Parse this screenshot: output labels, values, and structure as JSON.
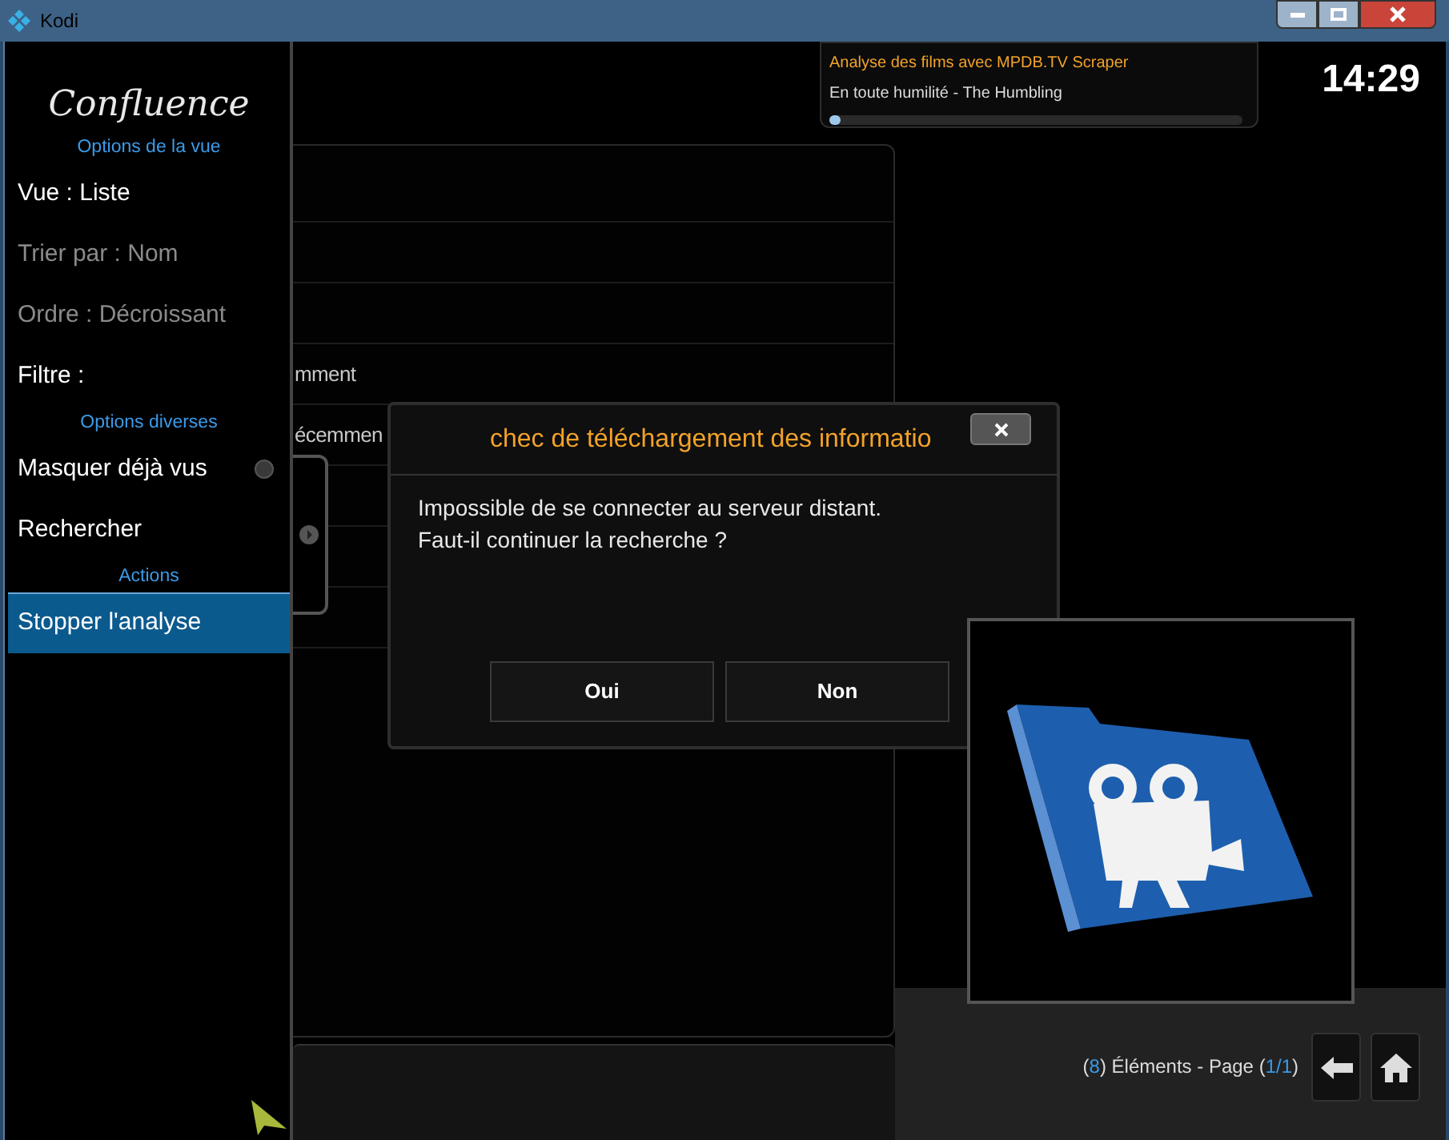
{
  "window": {
    "title": "Kodi"
  },
  "header": {
    "logo": "Confluence"
  },
  "progress": {
    "title": "Analyse des films avec MPDB.TV Scraper",
    "item": "En toute humilité - The Humbling",
    "level": 0.02
  },
  "clock": "14:29",
  "list": {
    "items": [
      {
        "kind": "hidden"
      },
      {
        "kind": "hidden"
      },
      {
        "kind": "hidden"
      },
      {
        "kind": "partial",
        "text": "mment"
      },
      {
        "kind": "partial",
        "text": "écemmen"
      },
      {
        "kind": "hidden"
      },
      {
        "kind": "hidden"
      },
      {
        "kind": "hidden"
      }
    ]
  },
  "sidebar": {
    "sections": [
      {
        "heading": "Options de la vue",
        "items": [
          {
            "label": "Vue : Liste",
            "kind": "button",
            "disabled": false,
            "selected": false
          },
          {
            "label": "Trier par : Nom",
            "kind": "button",
            "disabled": true,
            "selected": false
          },
          {
            "label": "Ordre : Décroissant",
            "kind": "button",
            "disabled": true,
            "selected": false
          },
          {
            "label": "Filtre :",
            "kind": "button",
            "disabled": false,
            "selected": false
          }
        ]
      },
      {
        "heading": "Options diverses",
        "items": [
          {
            "label": "Masquer déjà vus",
            "kind": "toggle",
            "on": false,
            "disabled": false,
            "selected": false
          },
          {
            "label": "Rechercher",
            "kind": "button",
            "disabled": false,
            "selected": false
          }
        ]
      },
      {
        "heading": "Actions",
        "items": [
          {
            "label": "Stopper l'analyse",
            "kind": "button",
            "disabled": false,
            "selected": true
          }
        ]
      }
    ]
  },
  "dialog": {
    "title": "chec de téléchargement des informatio",
    "message": [
      "Impossible de se connecter au serveur distant.",
      "Faut-il continuer la recherche ?"
    ],
    "buttons": [
      "Oui",
      "Non"
    ]
  },
  "footer": {
    "parts": [
      {
        "text": "(",
        "highlight": false
      },
      {
        "text": "8",
        "highlight": true
      },
      {
        "text": ") Éléments - Page (",
        "highlight": false
      },
      {
        "text": "1/1",
        "highlight": true
      },
      {
        "text": ")",
        "highlight": false
      }
    ]
  }
}
